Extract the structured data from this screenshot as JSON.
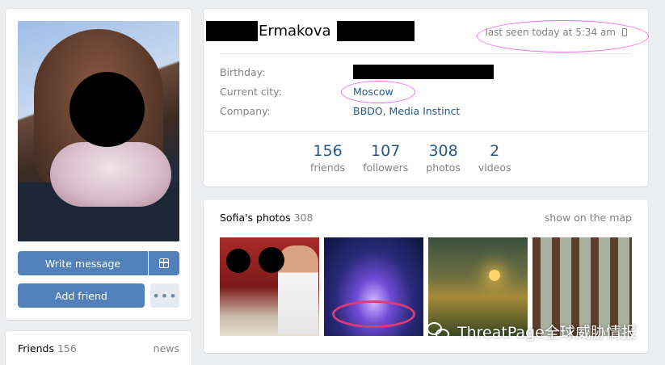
{
  "profile": {
    "last_name": "Ermakova",
    "last_seen": "last seen today at 5:34 am",
    "info": [
      {
        "label": "Birthday:",
        "value": ""
      },
      {
        "label": "Current city:",
        "value": "Moscow"
      },
      {
        "label": "Company:",
        "value": "BBDO, Media Instinct"
      }
    ],
    "counters": [
      {
        "value": "156",
        "label": "friends"
      },
      {
        "value": "107",
        "label": "followers"
      },
      {
        "value": "308",
        "label": "photos"
      },
      {
        "value": "2",
        "label": "videos"
      }
    ]
  },
  "actions": {
    "write_message": "Write message",
    "add_friend": "Add friend",
    "more": "•••"
  },
  "friends_block": {
    "title": "Friends",
    "count": "156",
    "news": "news"
  },
  "photos_block": {
    "title": "Sofia's photos",
    "count": "308",
    "map_link": "show on the map"
  },
  "icons": {
    "gift": "gift-icon",
    "mobile": "mobile-phone-icon",
    "watermark": "wechat-icon"
  },
  "watermark": {
    "text": "ThreatPage全球威胁情报"
  },
  "colors": {
    "accent": "#5181b8",
    "link": "#2a5885",
    "highlight_oval": "#f072ee",
    "background": "#edeef0"
  }
}
